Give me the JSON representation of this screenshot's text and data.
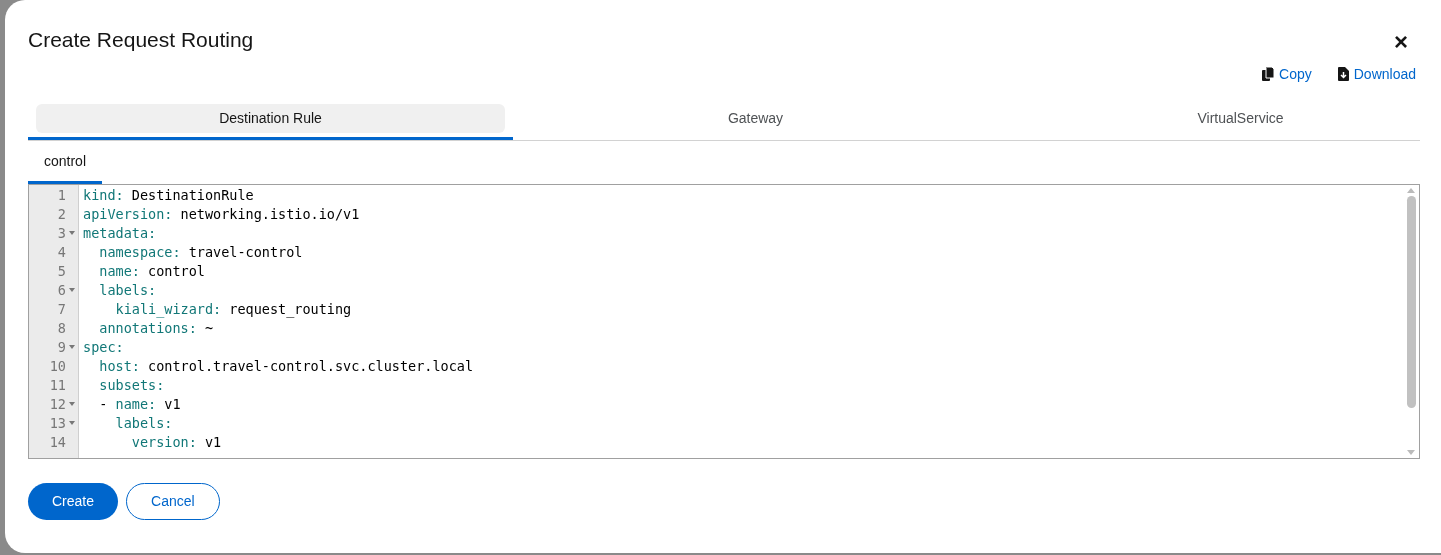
{
  "modal": {
    "title": "Create Request Routing",
    "close": "×"
  },
  "actions": [
    {
      "kind": "copy",
      "label": "Copy"
    },
    {
      "kind": "download",
      "label": "Download"
    }
  ],
  "tabs": [
    {
      "label": "Destination Rule",
      "selected": true
    },
    {
      "label": "Gateway",
      "selected": false
    },
    {
      "label": "VirtualService",
      "selected": false
    }
  ],
  "subtabs": [
    {
      "label": "control",
      "selected": true
    }
  ],
  "editor": {
    "lines": [
      {
        "number": "1",
        "key": "kind:",
        "value": "DestinationRule",
        "foldable": false
      },
      {
        "number": "2",
        "key": "apiVersion:",
        "value": "networking.istio.io/v1",
        "foldable": false
      },
      {
        "number": "3",
        "key": "metadata:",
        "foldable": true,
        "children": [
          {
            "number": "4",
            "key": "namespace:",
            "value": "travel-control",
            "foldable": false
          },
          {
            "number": "5",
            "key": "name:",
            "value": "control",
            "foldable": false
          },
          {
            "number": "6",
            "key": "labels:",
            "foldable": true,
            "children": [
              {
                "number": "7",
                "key": "kiali_wizard:",
                "value": "request_routing",
                "foldable": false
              }
            ]
          },
          {
            "number": "8",
            "key": "annotations:",
            "value": "~",
            "foldable": false
          }
        ]
      },
      {
        "number": "9",
        "key": "spec:",
        "foldable": true,
        "children": [
          {
            "number": "10",
            "key": "host:",
            "value": "control.travel-control.svc.cluster.local",
            "foldable": false
          },
          {
            "number": "11",
            "key": "subsets:",
            "foldable": false
          },
          {
            "number": "12",
            "bullet": "-",
            "key": "name:",
            "value": "v1",
            "foldable": true,
            "children": [
              {
                "number": "13",
                "key": "labels:",
                "foldable": true,
                "children": [
                  {
                    "number": "14",
                    "key": "version:",
                    "value": "v1",
                    "foldable": false
                  }
                ]
              }
            ]
          }
        ]
      }
    ]
  },
  "buttons": [
    {
      "kind": "primary",
      "label": "Create"
    },
    {
      "kind": "secondary",
      "label": "Cancel"
    }
  ]
}
